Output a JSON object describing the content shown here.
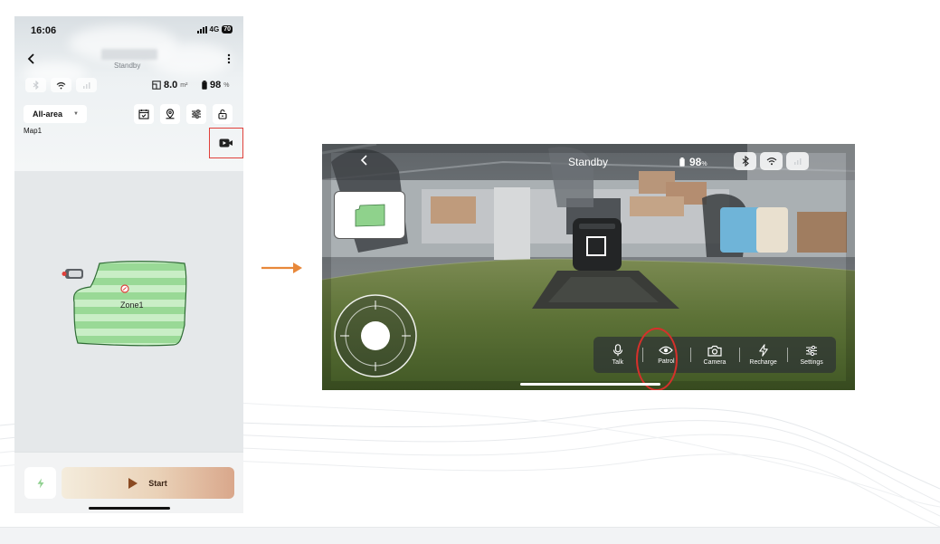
{
  "phone": {
    "status_bar": {
      "time": "16:06",
      "network": "4G",
      "battery": "70"
    },
    "header": {
      "status": "Standby"
    },
    "stats": {
      "area_value": "8.0",
      "area_unit": "m²",
      "battery_value": "98",
      "battery_unit": "%"
    },
    "area_selector": {
      "selected": "All-area"
    },
    "map_name": "Map1",
    "zone": {
      "name": "Zone1"
    },
    "bottom": {
      "start_label": "Start"
    },
    "icons": [
      "chevron-left-icon",
      "more-vertical-icon",
      "bluetooth-icon",
      "wifi-icon",
      "cellular-icon",
      "area-icon",
      "battery-icon",
      "chevron-down-icon",
      "schedule-icon",
      "location-icon",
      "sliders-icon",
      "unlock-icon",
      "video-camera-icon",
      "charge-icon",
      "play-icon"
    ]
  },
  "camera_view": {
    "title": "Standby",
    "battery_value": "98",
    "battery_unit": "%",
    "controls": [
      {
        "label": "Talk",
        "icon": "microphone-icon"
      },
      {
        "label": "Patrol",
        "icon": "eye-icon"
      },
      {
        "label": "Camera",
        "icon": "camera-icon"
      },
      {
        "label": "Recharge",
        "icon": "lightning-icon"
      },
      {
        "label": "Settings",
        "icon": "sliders-icon"
      }
    ],
    "icons": [
      "chevron-left-icon",
      "battery-icon",
      "bluetooth-icon",
      "wifi-icon",
      "cellular-icon",
      "joystick-icon"
    ]
  },
  "colors": {
    "accent_red": "#e0403b",
    "arrow_orange": "#e8883a",
    "zone_green": "#a8e0a4",
    "start_gradient_end": "#d9a78b"
  }
}
